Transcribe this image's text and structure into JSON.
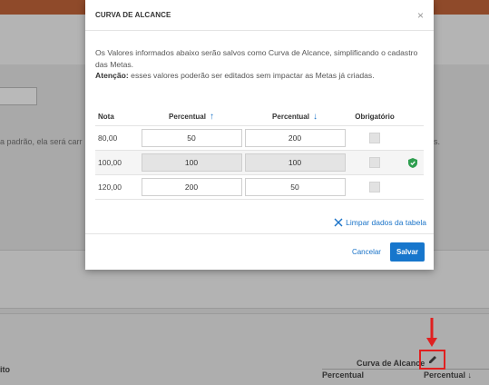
{
  "background": {
    "partial_text_left": "a padrão, ela será carr",
    "partial_text_right": "s.",
    "section_label": "ito",
    "curva_label": "Curva de Alcance",
    "percentual_1": "Percentual",
    "percentual_2": "Percentual",
    "sort_down_glyph": "↓"
  },
  "modal": {
    "title": "CURVA DE ALCANCE",
    "close_glyph": "×",
    "description": "Os Valores informados abaixo serão salvos como Curva de Alcance, simplificando o cadastro das Metas.",
    "warning_label": "Atenção:",
    "warning_text": " esses valores poderão ser editados sem impactar as Metas já criadas.",
    "table": {
      "headers": {
        "nota": "Nota",
        "percentual_1": "Percentual",
        "percentual_1_arrow": "↑",
        "percentual_2": "Percentual",
        "percentual_2_arrow": "↓",
        "obrigatorio": "Obrigatório"
      },
      "rows": [
        {
          "nota": "80,00",
          "p1": "50",
          "p2": "200"
        },
        {
          "nota": "100,00",
          "p1": "100",
          "p2": "100"
        },
        {
          "nota": "120,00",
          "p1": "200",
          "p2": "50"
        }
      ]
    },
    "clear_link": "Limpar dados da tabela",
    "cancel": "Cancelar",
    "save": "Salvar"
  },
  "colors": {
    "accent_blue": "#1776cc",
    "shield_green": "#2e9e4f",
    "highlight_red": "#e02020"
  },
  "icons": {
    "close": "close-icon",
    "shield": "shield-check-icon",
    "clear": "x-icon",
    "edit": "pencil-icon",
    "annotation": "red-down-arrow"
  }
}
